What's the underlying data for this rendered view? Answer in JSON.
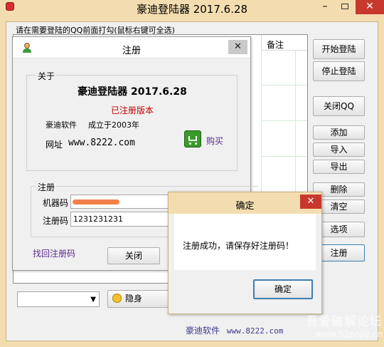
{
  "main": {
    "title": "豪迪登陆器 2017.6.28",
    "hint": "请在需要登陆的QQ前面打勾(鼠标右键可全选)",
    "col_note": "备注",
    "buttons": {
      "start": "开始登陆",
      "stop": "停止登陆",
      "close_qq": "关闭QQ",
      "add": "添加",
      "import": "导入",
      "export": "导出",
      "delete": "删除",
      "clear": "清空",
      "options": "选项",
      "register": "注册"
    },
    "invisible_label": "隐身",
    "footer_brand": "豪迪软件",
    "footer_url": "www.8222.com"
  },
  "register_dialog": {
    "title": "注册",
    "about_legend": "关于",
    "app_name": "豪迪登陆器  2017.6.28",
    "status": "已注册版本",
    "company": "豪迪软件",
    "founded": "成立于2003年",
    "url_label": "网址",
    "url": "www.8222.com",
    "buy": "购买",
    "reg_legend": "注册",
    "machine_label": "机器码",
    "regcode_label": "注册码",
    "regcode_value": "1231231231",
    "recover_link": "找回注册码",
    "close_button": "关闭"
  },
  "confirm_dialog": {
    "title": "确定",
    "message": "注册成功，请保存好注册码！",
    "ok_button": "确定"
  },
  "watermark": {
    "line1": "吾爱破解论坛",
    "line2": "www.52pojie.cn"
  },
  "colors": {
    "frame": "#f3ddb0",
    "close_red": "#c7392c",
    "status_red": "#c00000",
    "link_purple": "#5b2d8e",
    "grid_green": "#d6ead6"
  }
}
